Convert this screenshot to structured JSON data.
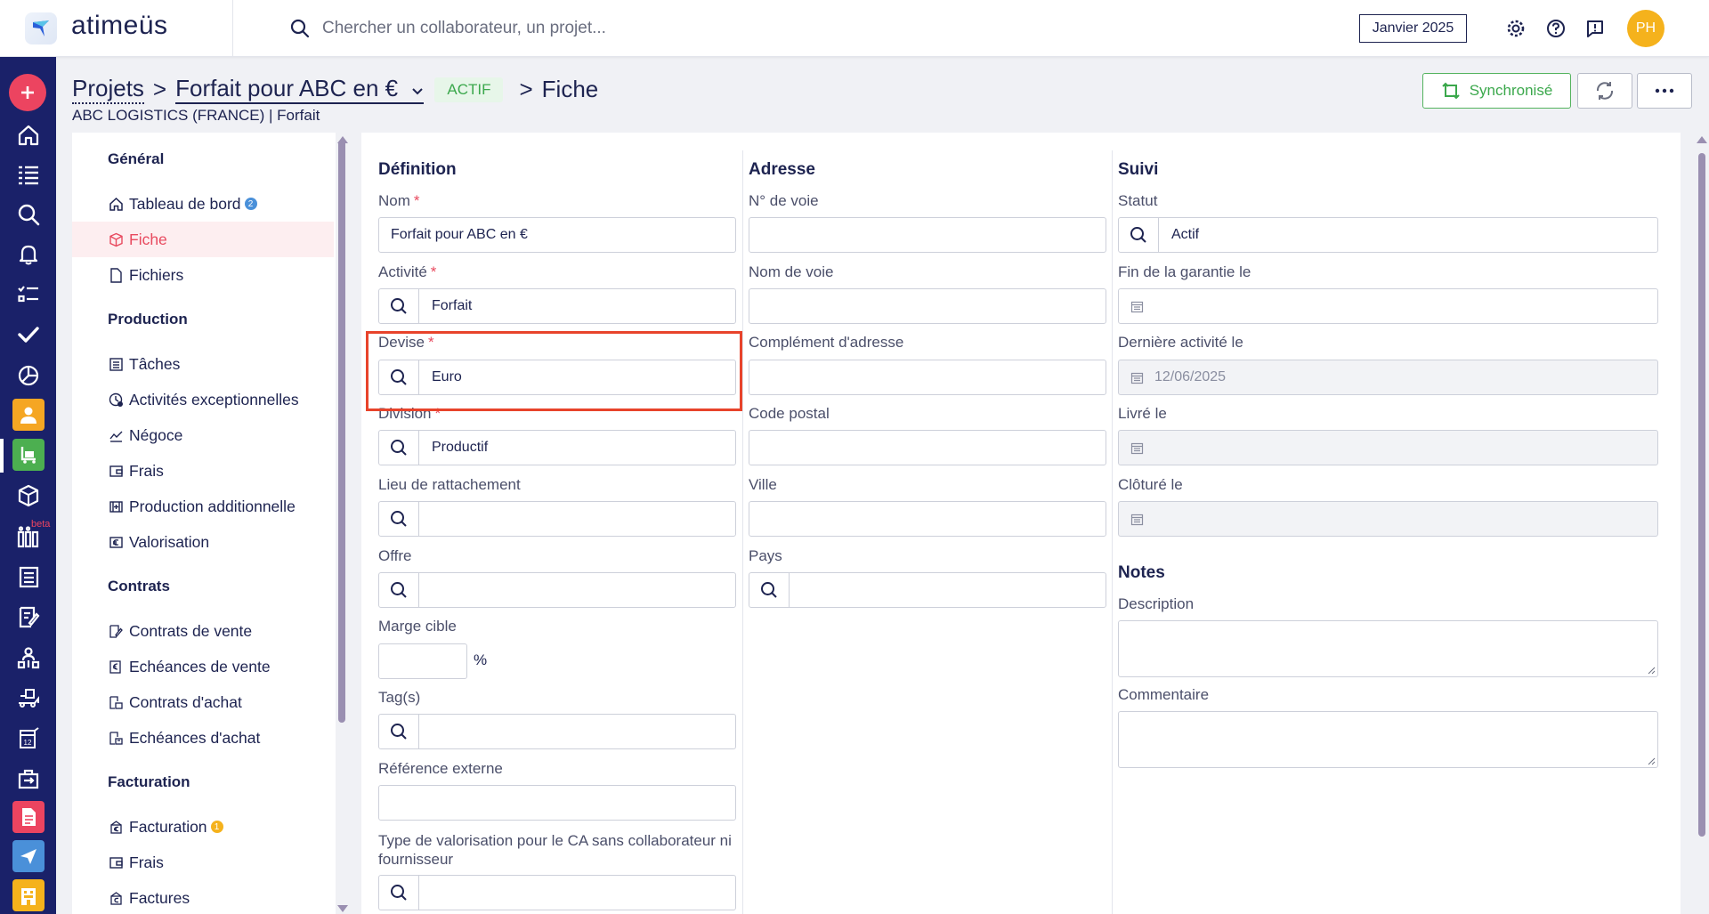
{
  "app": {
    "name": "atimeüs",
    "search_placeholder": "Chercher un collaborateur, un projet...",
    "period": "Janvier 2025",
    "user_initials": "PH",
    "colors": {
      "navy": "#1d2350",
      "rail": "#1a2169",
      "accent_red": "#e84a5f",
      "green": "#3ba84c",
      "avatar": "#f5b21c"
    }
  },
  "header": {
    "bc_projects": "Projets",
    "bc_sep1": ">",
    "bc_project": "Forfait pour ABC en €",
    "status": "ACTIF",
    "bc_sep2": ">",
    "bc_page": "Fiche",
    "subtitle": "ABC LOGISTICS (FRANCE) | Forfait",
    "sync_label": "Synchronisé"
  },
  "rail": {
    "beta_label": "beta",
    "icons": [
      "plus-icon",
      "home-icon",
      "list-icon",
      "search-icon",
      "bell-icon",
      "checklist-icon",
      "check-icon",
      "chart-icon",
      "person-icon",
      "cart-icon",
      "box-icon",
      "planning-icon",
      "document-icon",
      "contract-icon",
      "org-icon",
      "truck-icon",
      "calendar-icon",
      "briefcase-icon",
      "invoice-icon",
      "plane-icon",
      "hotel-icon"
    ]
  },
  "sidebar": {
    "sections": [
      {
        "title": "Général",
        "items": [
          {
            "label": "Tableau de bord",
            "icon": "home-icon",
            "badge": "2"
          },
          {
            "label": "Fiche",
            "icon": "box-icon",
            "active": true
          },
          {
            "label": "Fichiers",
            "icon": "file-icon"
          }
        ]
      },
      {
        "title": "Production",
        "items": [
          {
            "label": "Tâches",
            "icon": "tasks-icon"
          },
          {
            "label": "Activités exceptionnelles",
            "icon": "exceptional-icon"
          },
          {
            "label": "Négoce",
            "icon": "trend-icon"
          },
          {
            "label": "Frais",
            "icon": "wallet-icon"
          },
          {
            "label": "Production additionnelle",
            "icon": "additional-icon"
          },
          {
            "label": "Valorisation",
            "icon": "valuation-icon"
          }
        ]
      },
      {
        "title": "Contrats",
        "items": [
          {
            "label": "Contrats de vente",
            "icon": "sales-contract-icon"
          },
          {
            "label": "Echéances de vente",
            "icon": "sales-due-icon"
          },
          {
            "label": "Contrats d'achat",
            "icon": "purchase-contract-icon"
          },
          {
            "label": "Echéances d'achat",
            "icon": "purchase-due-icon"
          }
        ]
      },
      {
        "title": "Facturation",
        "items": [
          {
            "label": "Facturation",
            "icon": "billing-icon",
            "badge": "1"
          },
          {
            "label": "Frais",
            "icon": "wallet-icon"
          },
          {
            "label": "Factures",
            "icon": "invoices-icon"
          }
        ]
      }
    ]
  },
  "form": {
    "definition": {
      "title": "Définition",
      "nom_label": "Nom",
      "nom_value": "Forfait pour ABC en €",
      "activite_label": "Activité",
      "activite_value": "Forfait",
      "devise_label": "Devise",
      "devise_value": "Euro",
      "division_label": "Division",
      "division_value": "Productif",
      "lieu_label": "Lieu de rattachement",
      "lieu_value": "",
      "offre_label": "Offre",
      "offre_value": "",
      "marge_label": "Marge cible",
      "marge_value": "",
      "marge_unit": "%",
      "tags_label": "Tag(s)",
      "tags_value": "",
      "ref_label": "Référence externe",
      "ref_value": "",
      "type_val_label": "Type de valorisation pour le CA sans collaborateur ni fournisseur",
      "type_val_value": "",
      "required_mark": "*"
    },
    "adresse": {
      "title": "Adresse",
      "numero_label": "N° de voie",
      "nom_voie_label": "Nom de voie",
      "complement_label": "Complément d'adresse",
      "cp_label": "Code postal",
      "ville_label": "Ville",
      "pays_label": "Pays"
    },
    "suivi": {
      "title": "Suivi",
      "statut_label": "Statut",
      "statut_value": "Actif",
      "garantie_label": "Fin de la garantie le",
      "derniere_label": "Dernière activité le",
      "derniere_value": "12/06/2025",
      "livre_label": "Livré le",
      "cloture_label": "Clôturé le"
    },
    "notes": {
      "title": "Notes",
      "description_label": "Description",
      "commentaire_label": "Commentaire"
    }
  }
}
